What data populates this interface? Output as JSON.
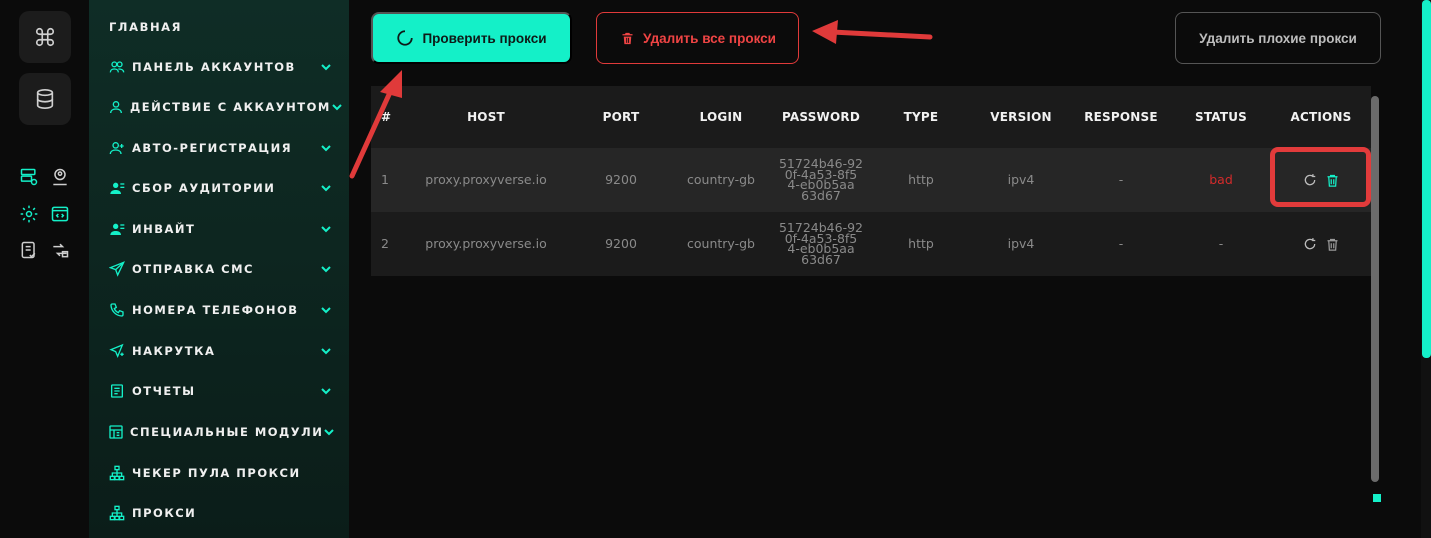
{
  "sidebar": {
    "home": "ГЛАВНАЯ",
    "items": [
      {
        "label": "ПАНЕЛЬ АККАУНТОВ",
        "icon": "users-icon",
        "has_chevron": true
      },
      {
        "label": "ДЕЙСТВИЕ С АККАУНТОМ",
        "icon": "user-icon",
        "has_chevron": true
      },
      {
        "label": "АВТО-РЕГИСТРАЦИЯ",
        "icon": "user-plus-icon",
        "has_chevron": true
      },
      {
        "label": "СБОР АУДИТОРИИ",
        "icon": "user-group-icon",
        "has_chevron": true
      },
      {
        "label": "ИНВАЙТ",
        "icon": "user-invite-icon",
        "has_chevron": true
      },
      {
        "label": "ОТПРАВКА СМС",
        "icon": "send-icon",
        "has_chevron": true
      },
      {
        "label": "НОМЕРА ТЕЛЕФОНОВ",
        "icon": "phone-icon",
        "has_chevron": true
      },
      {
        "label": "НАКРУТКА",
        "icon": "boost-icon",
        "has_chevron": true
      },
      {
        "label": "ОТЧЕТЫ",
        "icon": "report-icon",
        "has_chevron": true
      },
      {
        "label": "СПЕЦИАЛЬНЫЕ МОДУЛИ",
        "icon": "modules-icon",
        "has_chevron": true
      },
      {
        "label": "ЧЕКЕР ПУЛА ПРОКСИ",
        "icon": "network-icon",
        "has_chevron": false
      },
      {
        "label": "ПРОКСИ",
        "icon": "network-icon",
        "has_chevron": false
      }
    ]
  },
  "toolbar": {
    "check_label": "Проверить прокси",
    "delete_all_label": "Удалить все прокси",
    "delete_bad_label": "Удалить плохие прокси"
  },
  "table": {
    "headers": [
      "#",
      "HOST",
      "PORT",
      "LOGIN",
      "PASSWORD",
      "TYPE",
      "VERSION",
      "RESPONSE",
      "STATUS",
      "ACTIONS"
    ],
    "rows": [
      {
        "num": "1",
        "host": "proxy.proxyverse.io",
        "port": "9200",
        "login": "country-gb",
        "password": "51724b46-92\n0f-4a53-8f5\n4-eb0b5aa\n63d67",
        "type": "http",
        "version": "ipv4",
        "response": "-",
        "status": "bad"
      },
      {
        "num": "2",
        "host": "proxy.proxyverse.io",
        "port": "9200",
        "login": "country-gb",
        "password": "51724b46-92\n0f-4a53-8f5\n4-eb0b5aa\n63d67",
        "type": "http",
        "version": "ipv4",
        "response": "-",
        "status": "-"
      }
    ]
  },
  "colors": {
    "accent": "#14f0c8",
    "danger": "#ef4444",
    "annotation_red": "#e23b3b",
    "status_bad": "#d32b2b"
  }
}
